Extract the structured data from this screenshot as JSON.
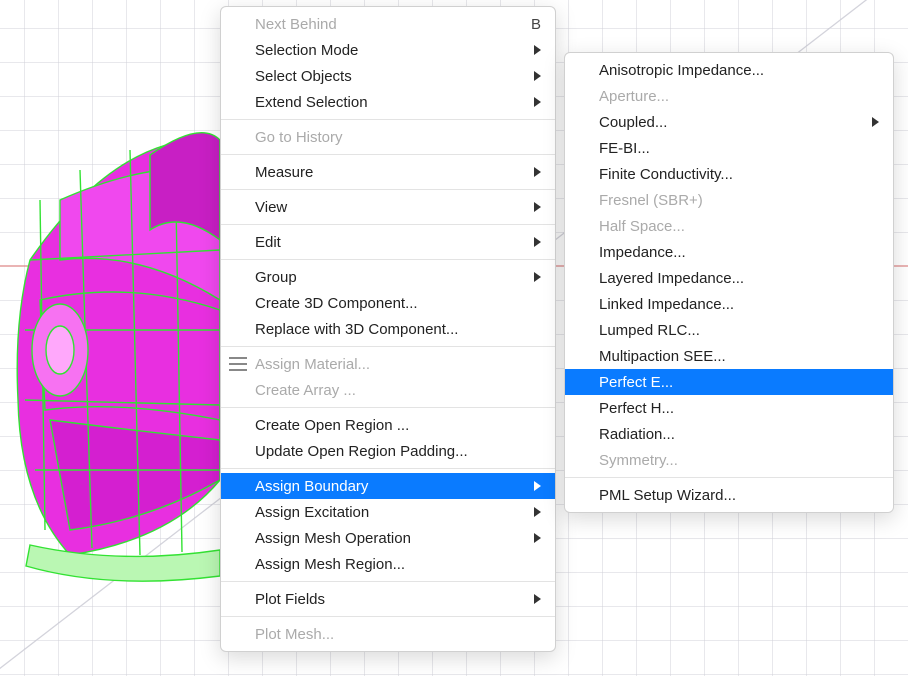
{
  "primaryMenu": {
    "items": [
      {
        "label": "Next Behind",
        "shortcut": "B",
        "disabled": true
      },
      {
        "label": "Selection Mode",
        "submenu": true
      },
      {
        "label": "Select Objects",
        "submenu": true
      },
      {
        "label": "Extend Selection",
        "submenu": true
      },
      {
        "sep": true
      },
      {
        "label": "Go to History",
        "disabled": true
      },
      {
        "sep": true
      },
      {
        "label": "Measure",
        "submenu": true
      },
      {
        "sep": true
      },
      {
        "label": "View",
        "submenu": true
      },
      {
        "sep": true
      },
      {
        "label": "Edit",
        "submenu": true
      },
      {
        "sep": true
      },
      {
        "label": "Group",
        "submenu": true
      },
      {
        "label": "Create 3D Component..."
      },
      {
        "label": "Replace with 3D Component..."
      },
      {
        "sep": true
      },
      {
        "label": "Assign Material...",
        "disabled": true,
        "icon": "material-icon"
      },
      {
        "label": "Create Array ...",
        "disabled": true
      },
      {
        "sep": true
      },
      {
        "label": "Create Open Region ..."
      },
      {
        "label": "Update Open Region Padding..."
      },
      {
        "sep": true
      },
      {
        "label": "Assign Boundary",
        "submenu": true,
        "highlight": true
      },
      {
        "label": "Assign Excitation",
        "submenu": true
      },
      {
        "label": "Assign Mesh Operation",
        "submenu": true
      },
      {
        "label": "Assign Mesh Region..."
      },
      {
        "sep": true
      },
      {
        "label": "Plot Fields",
        "submenu": true
      },
      {
        "sep": true
      },
      {
        "label": "Plot Mesh...",
        "disabled": true
      }
    ]
  },
  "secondaryMenu": {
    "items": [
      {
        "label": "Anisotropic Impedance..."
      },
      {
        "label": "Aperture...",
        "disabled": true
      },
      {
        "label": "Coupled...",
        "submenu": true
      },
      {
        "label": "FE-BI..."
      },
      {
        "label": "Finite Conductivity..."
      },
      {
        "label": "Fresnel (SBR+)",
        "disabled": true
      },
      {
        "label": "Half Space...",
        "disabled": true
      },
      {
        "label": "Impedance..."
      },
      {
        "label": "Layered Impedance..."
      },
      {
        "label": "Linked Impedance..."
      },
      {
        "label": "Lumped RLC..."
      },
      {
        "label": "Multipaction SEE..."
      },
      {
        "label": "Perfect E...",
        "highlight": true
      },
      {
        "label": "Perfect H..."
      },
      {
        "label": "Radiation..."
      },
      {
        "label": "Symmetry...",
        "disabled": true
      },
      {
        "sep": true
      },
      {
        "label": "PML Setup Wizard..."
      }
    ]
  }
}
